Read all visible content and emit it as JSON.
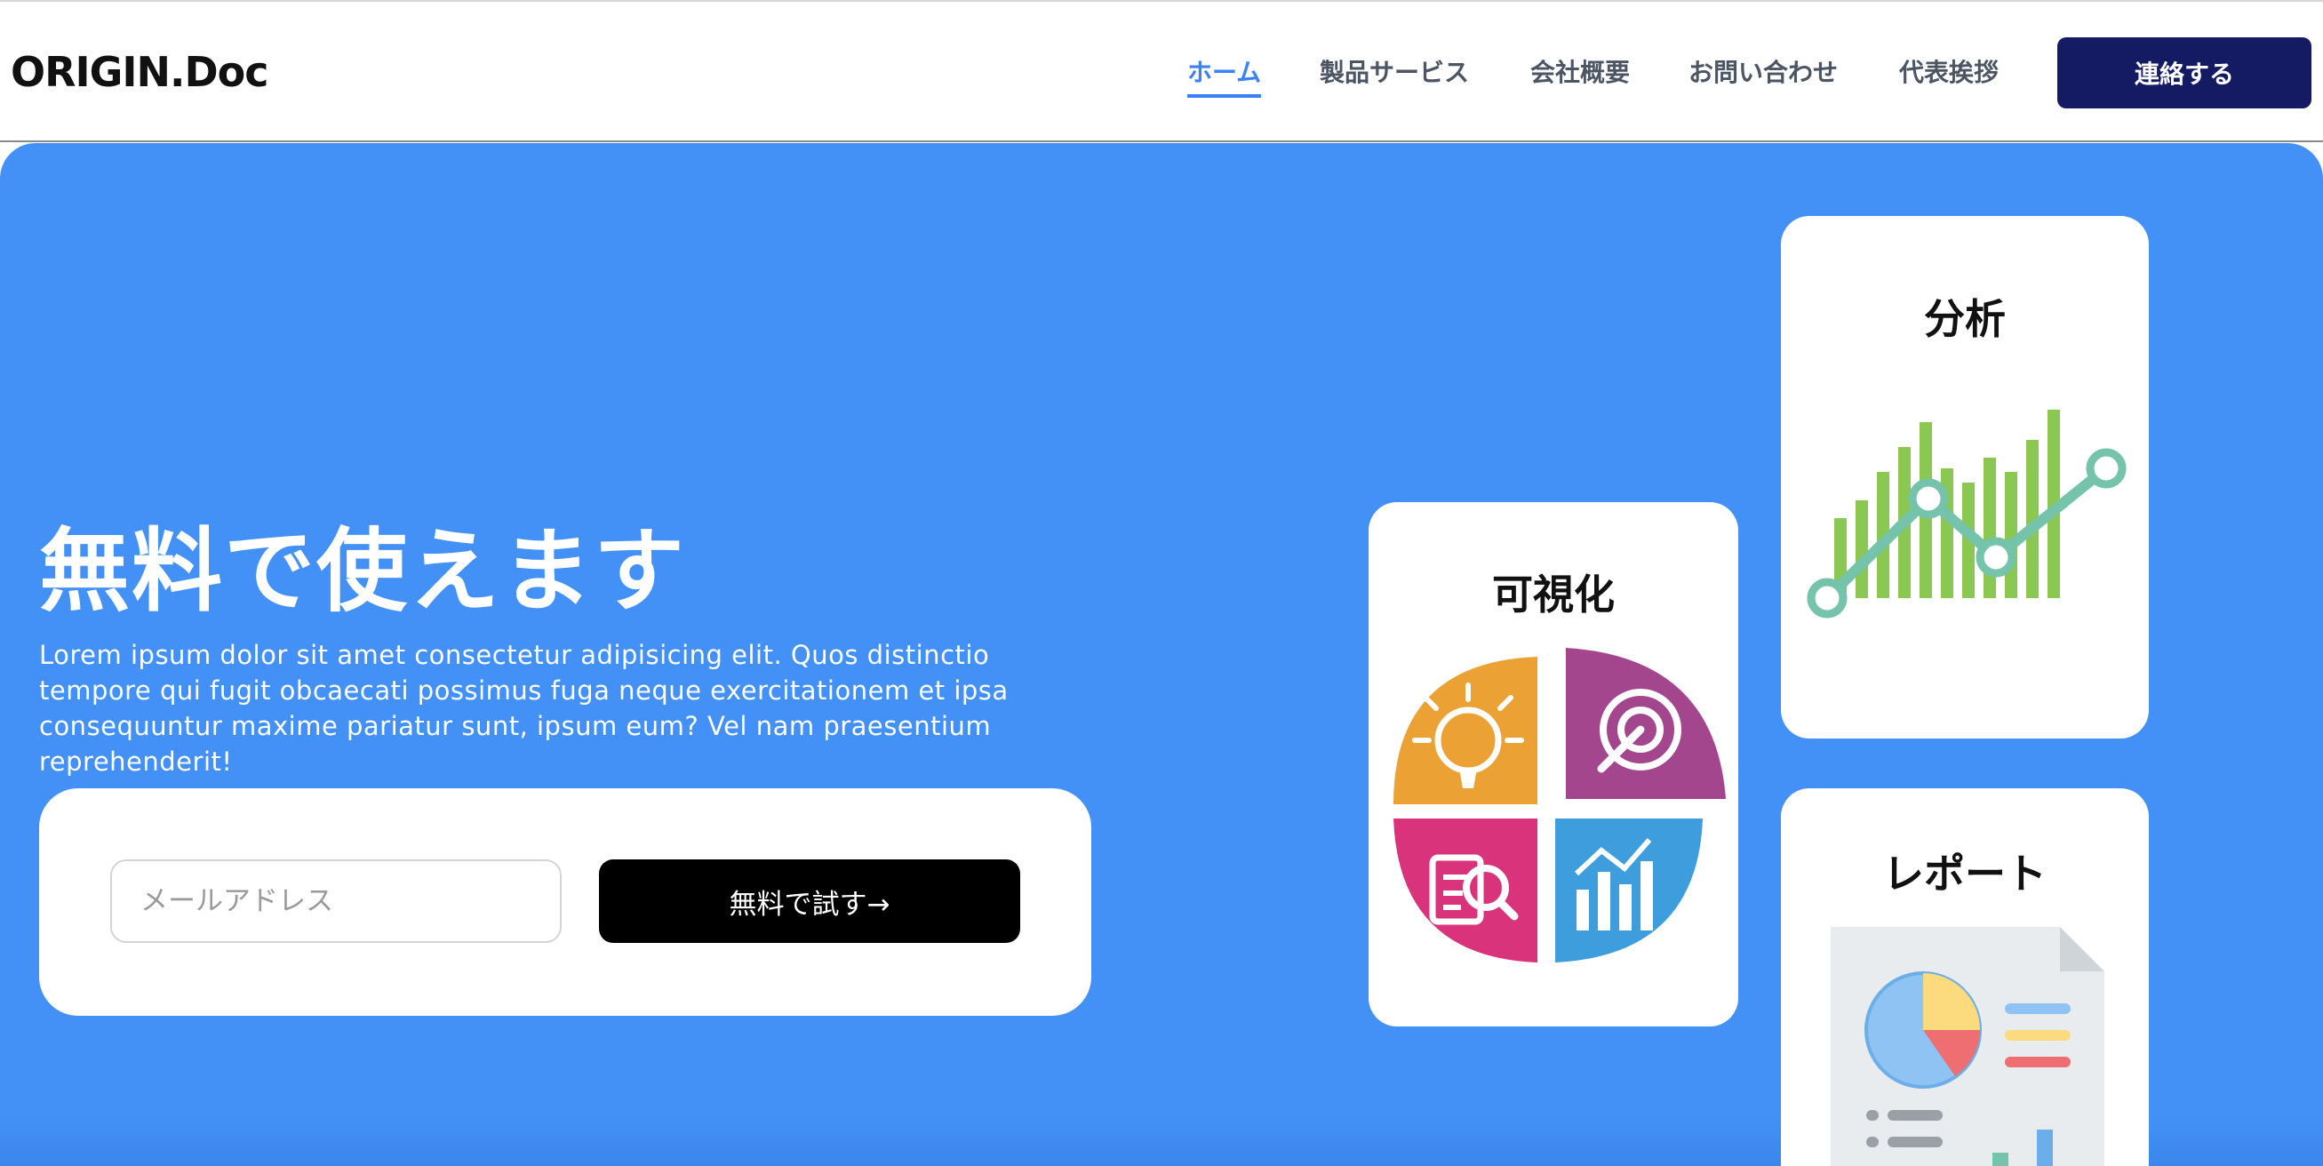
{
  "header": {
    "logo": "ORIGIN.Doc",
    "nav": [
      {
        "label": "ホーム",
        "active": true
      },
      {
        "label": "製品サービス",
        "active": false
      },
      {
        "label": "会社概要",
        "active": false
      },
      {
        "label": "お問い合わせ",
        "active": false
      },
      {
        "label": "代表挨拶",
        "active": false
      }
    ],
    "cta_label": "連絡する"
  },
  "hero": {
    "title": "無料で使えます",
    "description": "Lorem ipsum dolor sit amet consectetur adipisicing elit. Quos distinctio tempore qui fugit obcaecati possimus fuga neque exercitationem et ipsa consequuntur maxime pariatur sunt, ipsum eum? Vel nam praesentium reprehenderit!",
    "email_placeholder": "メールアドレス",
    "try_button_label": "無料で試す→"
  },
  "cards": {
    "visualize": {
      "title": "可視化"
    },
    "analysis": {
      "title": "分析"
    },
    "report": {
      "title": "レポート"
    }
  },
  "colors": {
    "hero_bg": "#4391f7",
    "nav_active": "#3b82f6",
    "cta_bg": "#151b63",
    "try_button_bg": "#000000"
  }
}
